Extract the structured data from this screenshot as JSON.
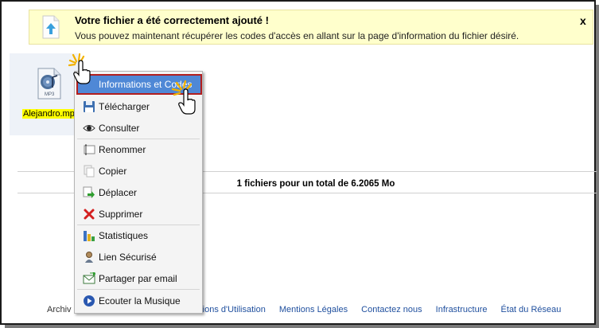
{
  "notice": {
    "title": "Votre fichier a été correctement ajouté !",
    "message": "Vous pouvez maintenant récupérer les codes d'accès en allant sur la page d'information du fichier désiré.",
    "close_label": "x"
  },
  "file": {
    "name": "Alejandro.mp3",
    "icon_label": "MP3"
  },
  "summary": "1 fichiers pour un total de 6.2065 Mo",
  "context_menu": {
    "items": [
      {
        "label": "Informations et Codes",
        "icon": "info-icon"
      },
      {
        "label": "Télécharger",
        "icon": "floppy-disk-icon"
      },
      {
        "label": "Consulter",
        "icon": "eye-icon"
      },
      {
        "label": "Renommer",
        "icon": "rename-icon"
      },
      {
        "label": "Copier",
        "icon": "copy-icon"
      },
      {
        "label": "Déplacer",
        "icon": "move-icon"
      },
      {
        "label": "Supprimer",
        "icon": "delete-icon"
      },
      {
        "label": "Statistiques",
        "icon": "chart-icon"
      },
      {
        "label": "Lien Sécurisé",
        "icon": "secure-link-icon"
      },
      {
        "label": "Partager par email",
        "icon": "email-icon"
      },
      {
        "label": "Ecouter la Musique",
        "icon": "play-icon"
      }
    ]
  },
  "footer": {
    "truncated_left": "Archiv",
    "links": [
      "...itions d'Utilisation",
      "Mentions Légales",
      "Contactez nous",
      "Infrastructure",
      "État du Réseau"
    ]
  },
  "colors": {
    "notice_bg": "#ffffcc",
    "menu_highlight": "#4f88d6",
    "highlight_border": "#b21e1e",
    "link": "#1f4f9e"
  }
}
